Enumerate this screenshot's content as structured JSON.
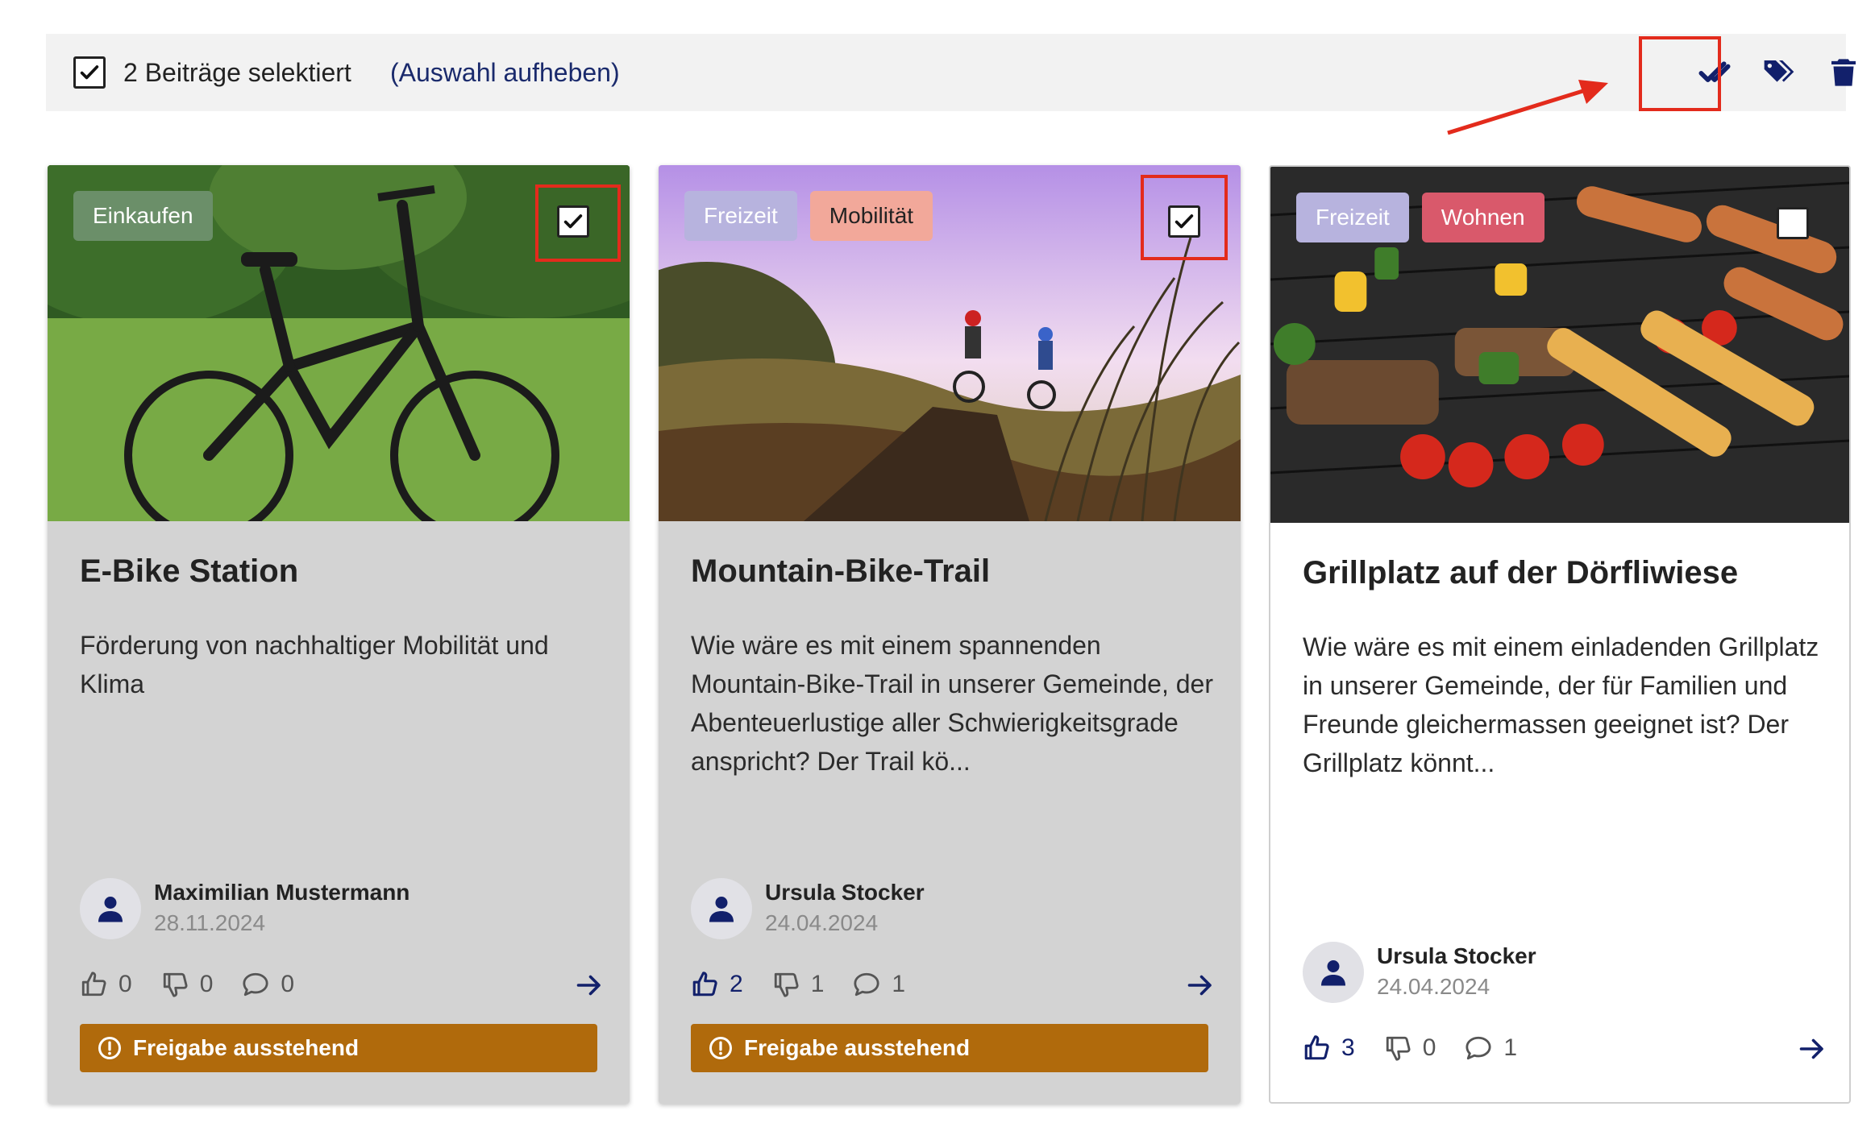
{
  "selection": {
    "count_text": "2 Beiträge selektiert",
    "clear_link": "(Auswahl aufheben)",
    "actions": [
      "approve-all-icon",
      "tags-icon",
      "trash-icon"
    ]
  },
  "colors": {
    "accent": "#12206b",
    "highlight": "#e32b1c",
    "status_pending": "#b06a0c",
    "card_selected_bg": "#d3d3d3"
  },
  "cards": [
    {
      "tags": [
        {
          "label": "Einkaufen",
          "bg": "#6b8f69",
          "fg": "#ffffff"
        }
      ],
      "selected": true,
      "title": "E-Bike Station",
      "description": "Förderung von nachhaltiger Mobilität und Klima",
      "author": "Maximilian Mustermann",
      "date": "28.11.2024",
      "likes": "0",
      "dislikes": "0",
      "comments": "0",
      "status": "Freigabe ausstehend"
    },
    {
      "tags": [
        {
          "label": "Freizeit",
          "bg": "#b7b3de",
          "fg": "#ffffff"
        },
        {
          "label": "Mobilität",
          "bg": "#f2a89a",
          "fg": "#222222"
        }
      ],
      "selected": true,
      "title": "Mountain-Bike-Trail",
      "description": "Wie wäre es mit einem spannenden Mountain-Bike-Trail in unserer Gemeinde, der Abenteuerlustige aller Schwierigkeitsgrade anspricht? Der Trail kö...",
      "author": "Ursula Stocker",
      "date": "24.04.2024",
      "likes": "2",
      "dislikes": "1",
      "comments": "1",
      "status": "Freigabe ausstehend"
    },
    {
      "tags": [
        {
          "label": "Freizeit",
          "bg": "#b7b3de",
          "fg": "#ffffff"
        },
        {
          "label": "Wohnen",
          "bg": "#d9596b",
          "fg": "#ffffff"
        }
      ],
      "selected": false,
      "title": "Grillplatz auf der Dörfliwiese",
      "description": "Wie wäre es mit einem einladenden Grillplatz in unserer Gemeinde, der für Familien und Freunde gleichermassen geeignet ist? Der Grillplatz könnt...",
      "author": "Ursula Stocker",
      "date": "24.04.2024",
      "likes": "3",
      "dislikes": "0",
      "comments": "1",
      "status": ""
    }
  ]
}
